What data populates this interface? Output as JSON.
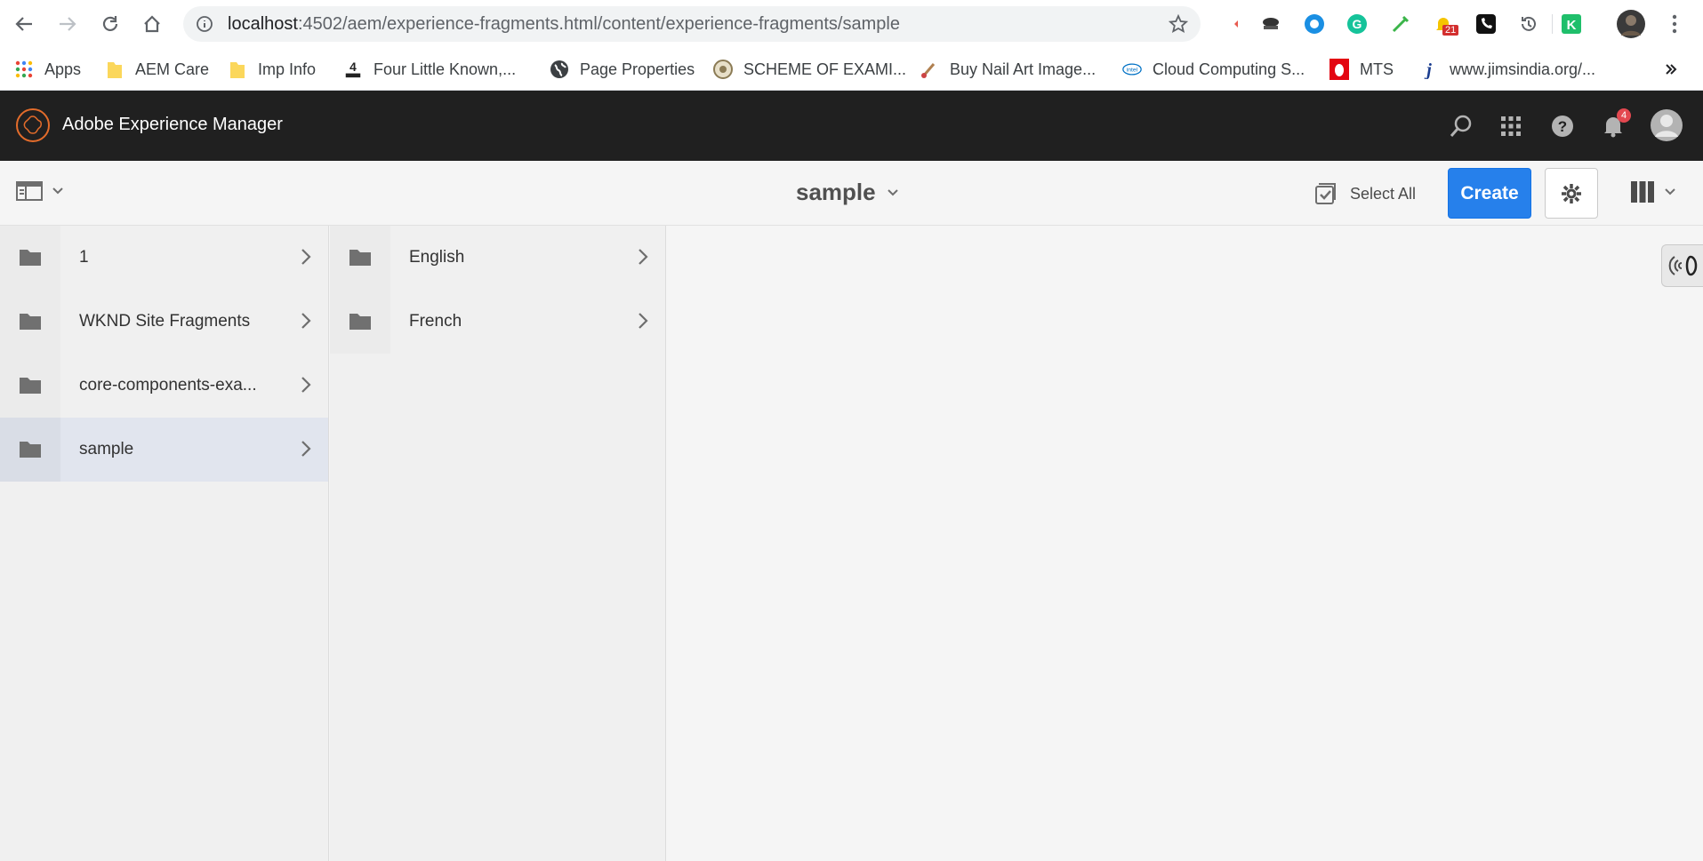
{
  "browser": {
    "url_host": "localhost",
    "url_rest": ":4502/aem/experience-fragments.html/content/experience-fragments/sample",
    "extension_badge": "21"
  },
  "bookmarks": [
    {
      "label": "Apps",
      "icon": "apps-grid-icon"
    },
    {
      "label": "AEM Care",
      "icon": "folder-icon"
    },
    {
      "label": "Imp Info",
      "icon": "folder-icon"
    },
    {
      "label": "Four Little Known,...",
      "icon": "guys-logo-icon"
    },
    {
      "label": "Page Properties",
      "icon": "globe-icon"
    },
    {
      "label": "SCHEME OF EXAMI...",
      "icon": "seal-icon"
    },
    {
      "label": "Buy Nail Art Image...",
      "icon": "brush-icon"
    },
    {
      "label": "Cloud Computing S...",
      "icon": "intel-icon"
    },
    {
      "label": "MTS",
      "icon": "mts-icon"
    },
    {
      "label": "www.jimsindia.org/...",
      "icon": "j-icon"
    }
  ],
  "aem": {
    "title": "Adobe Experience Manager",
    "notification_count": "4"
  },
  "action_bar": {
    "title": "sample",
    "select_all_label": "Select All",
    "create_label": "Create"
  },
  "column1": [
    {
      "label": "1",
      "selected": false
    },
    {
      "label": "WKND Site Fragments",
      "selected": false
    },
    {
      "label": "core-components-exa...",
      "selected": false
    },
    {
      "label": "sample",
      "selected": true
    }
  ],
  "column2": [
    {
      "label": "English"
    },
    {
      "label": "French"
    }
  ]
}
